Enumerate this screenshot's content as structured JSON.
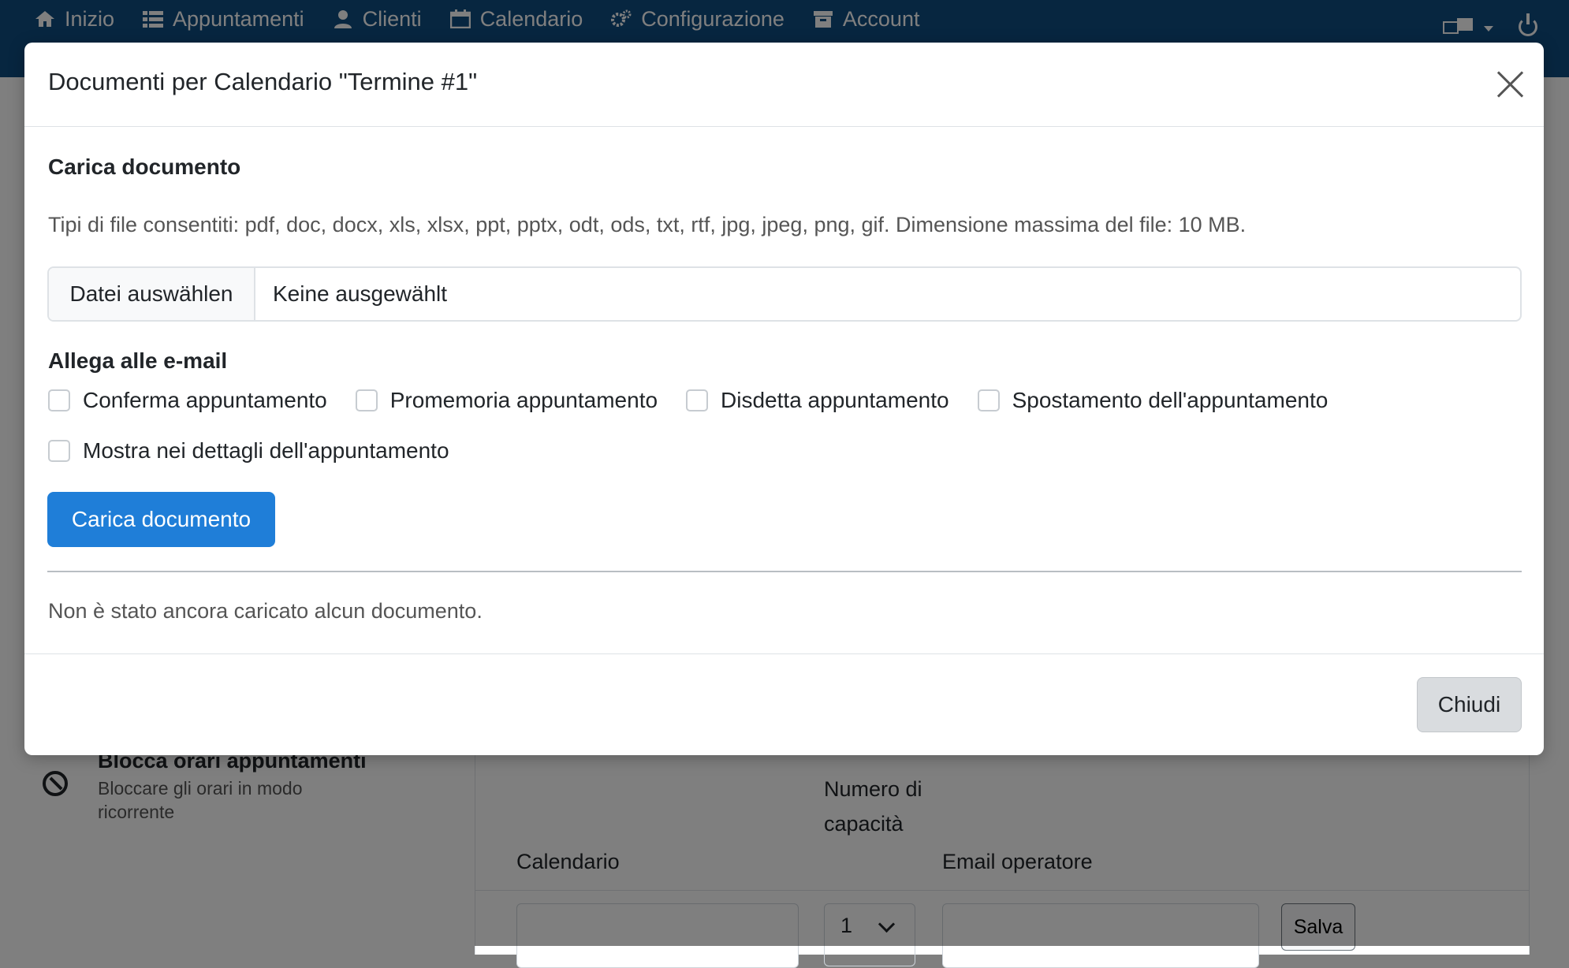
{
  "navbar": {
    "items": [
      {
        "label": "Inizio",
        "icon": "home-icon"
      },
      {
        "label": "Appuntamenti",
        "icon": "list-icon"
      },
      {
        "label": "Clienti",
        "icon": "user-icon"
      },
      {
        "label": "Calendario",
        "icon": "calendar-icon"
      },
      {
        "label": "Configurazione",
        "icon": "gears-icon"
      },
      {
        "label": "Account",
        "icon": "archive-icon"
      }
    ]
  },
  "background": {
    "block_item": {
      "title": "Blocca orari appuntamenti",
      "description": "Bloccare gli orari in modo ricorrente"
    },
    "table": {
      "headers": [
        "Calendario",
        "Numero di capacità",
        "Email operatore"
      ],
      "capacity_value": "1",
      "save_label": "Salva"
    }
  },
  "modal": {
    "title": "Documenti per Calendario \"Termine #1\"",
    "upload_section_title": "Carica documento",
    "allowed_types_hint": "Tipi di file consentiti: pdf, doc, docx, xls, xlsx, ppt, pptx, odt, ods, txt, rtf, jpg, jpeg, png, gif. Dimensione massima del file: 10 MB.",
    "file_button_label": "Datei auswählen",
    "file_status": "Keine ausgewählt",
    "attach_section_title": "Allega alle e-mail",
    "checkboxes": [
      {
        "label": "Conferma appuntamento",
        "checked": false
      },
      {
        "label": "Promemoria appuntamento",
        "checked": false
      },
      {
        "label": "Disdetta appuntamento",
        "checked": false
      },
      {
        "label": "Spostamento dell'appuntamento",
        "checked": false
      }
    ],
    "details_checkbox": {
      "label": "Mostra nei dettagli dell'appuntamento",
      "checked": false
    },
    "upload_button_label": "Carica documento",
    "empty_message": "Non è stato ancora caricato alcun documento.",
    "close_button_label": "Chiudi"
  },
  "colors": {
    "navbar": "#0f4c81",
    "primary": "#1f7ed8",
    "secondary_button": "#d9dcdf"
  }
}
